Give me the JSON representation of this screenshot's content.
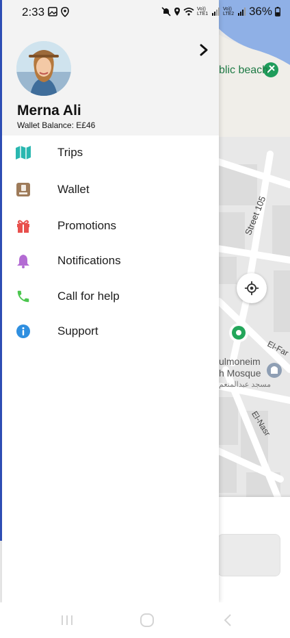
{
  "status_bar": {
    "time": "2:33",
    "battery": "36%",
    "net1": "Vo)) LTE1",
    "net2": "Vo)) LTE2"
  },
  "profile": {
    "name": "Merna Ali",
    "wallet_balance": "Wallet Balance: E£46"
  },
  "menu": {
    "items": [
      {
        "label": "Trips",
        "icon": "map-icon",
        "color": "#2ab7b0"
      },
      {
        "label": "Wallet",
        "icon": "wallet-icon",
        "color": "#9e7b5a"
      },
      {
        "label": "Promotions",
        "icon": "gift-icon",
        "color": "#e8504d"
      },
      {
        "label": "Notifications",
        "icon": "bell-icon",
        "color": "#b36bd3"
      },
      {
        "label": "Call for help",
        "icon": "phone-icon",
        "color": "#4cc64f"
      },
      {
        "label": "Support",
        "icon": "info-icon",
        "color": "#2f8fe0"
      }
    ]
  },
  "map": {
    "beach": "blic beach",
    "street": "Street 105",
    "el_far": "El-Far",
    "mosque_line1": "ulmoneim",
    "mosque_line2": "h Mosque",
    "mosque_line3": "مسجد عبدالمنعم",
    "el_nasr": "El-Nasr"
  },
  "colors": {
    "accent_green": "#23a65a",
    "drawer_header_bg": "#f3f3f3",
    "map_bg": "#e9e9e9",
    "water": "#8fb0e6"
  }
}
